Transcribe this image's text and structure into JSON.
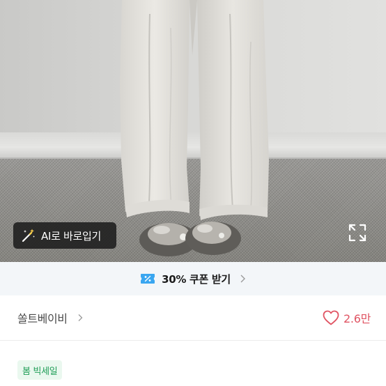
{
  "photo": {
    "ai_try_on_label": "AI로 바로입기",
    "ai_icon": "magic-wand-icon",
    "expand_icon": "expand-icon"
  },
  "coupon": {
    "icon": "coupon-percent-icon",
    "text": "30% 쿠폰 받기",
    "accent": "#3aa6f0"
  },
  "shop": {
    "name": "쏠트베이비",
    "like_count": "2.6만",
    "like_color": "#e05463"
  },
  "badge": {
    "text": "봄 빅세일",
    "color": "#1f9d57",
    "background": "#eaf8ef"
  }
}
